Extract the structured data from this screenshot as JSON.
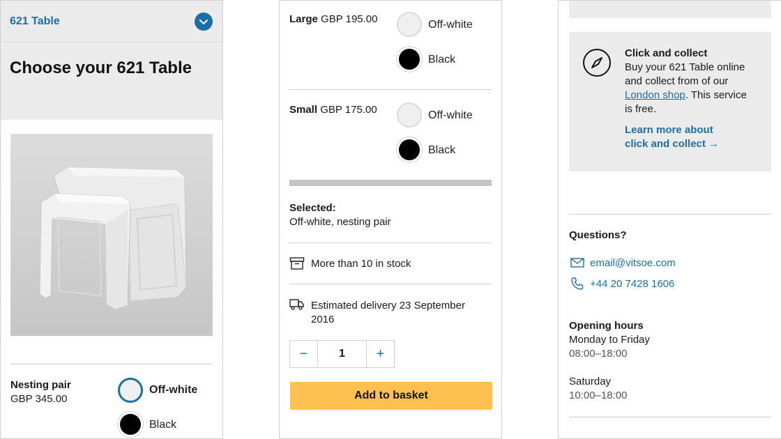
{
  "panel1": {
    "header_title": "621 Table",
    "heading": "Choose your 621 Table",
    "product": {
      "name": "Nesting pair",
      "price": "GBP 345.00",
      "options": [
        "Off-white",
        "Black"
      ],
      "selected": "Off-white"
    }
  },
  "panel2": {
    "large": {
      "name": "Large",
      "price": "GBP 195.00",
      "options": [
        "Off-white",
        "Black"
      ]
    },
    "small": {
      "name": "Small",
      "price": "GBP 175.00",
      "options": [
        "Off-white",
        "Black"
      ]
    },
    "selected_label": "Selected:",
    "selected_value": "Off-white, nesting pair",
    "stock_text": "More than 10 in stock",
    "delivery_line1": "Estimated delivery 23 September",
    "delivery_line2": "2016",
    "quantity": "1",
    "minus": "−",
    "plus": "+",
    "add_to_basket": "Add to basket"
  },
  "panel3": {
    "click_collect": {
      "title": "Click and collect",
      "line1": "Buy your 621 Table online",
      "line2": "and collect from of our",
      "link": "London shop",
      "line3_rest": ". This service",
      "line4": "is free.",
      "learn_line1": "Learn more about",
      "learn_line2": "click and collect →"
    },
    "questions_title": "Questions?",
    "email": "email@vitsoe.com",
    "phone": "+44 20 7428 1606",
    "opening_title": "Opening hours",
    "weekday_label": "Monday to Friday",
    "weekday_hours": "08:00–18:00",
    "saturday_label": "Saturday",
    "saturday_hours": "10:00–18:00"
  },
  "colors": {
    "accent_blue": "#1a6fa6",
    "basket_yellow": "#fec14f",
    "panel_grey": "#ebebeb",
    "divider": "#cfcfcf"
  }
}
